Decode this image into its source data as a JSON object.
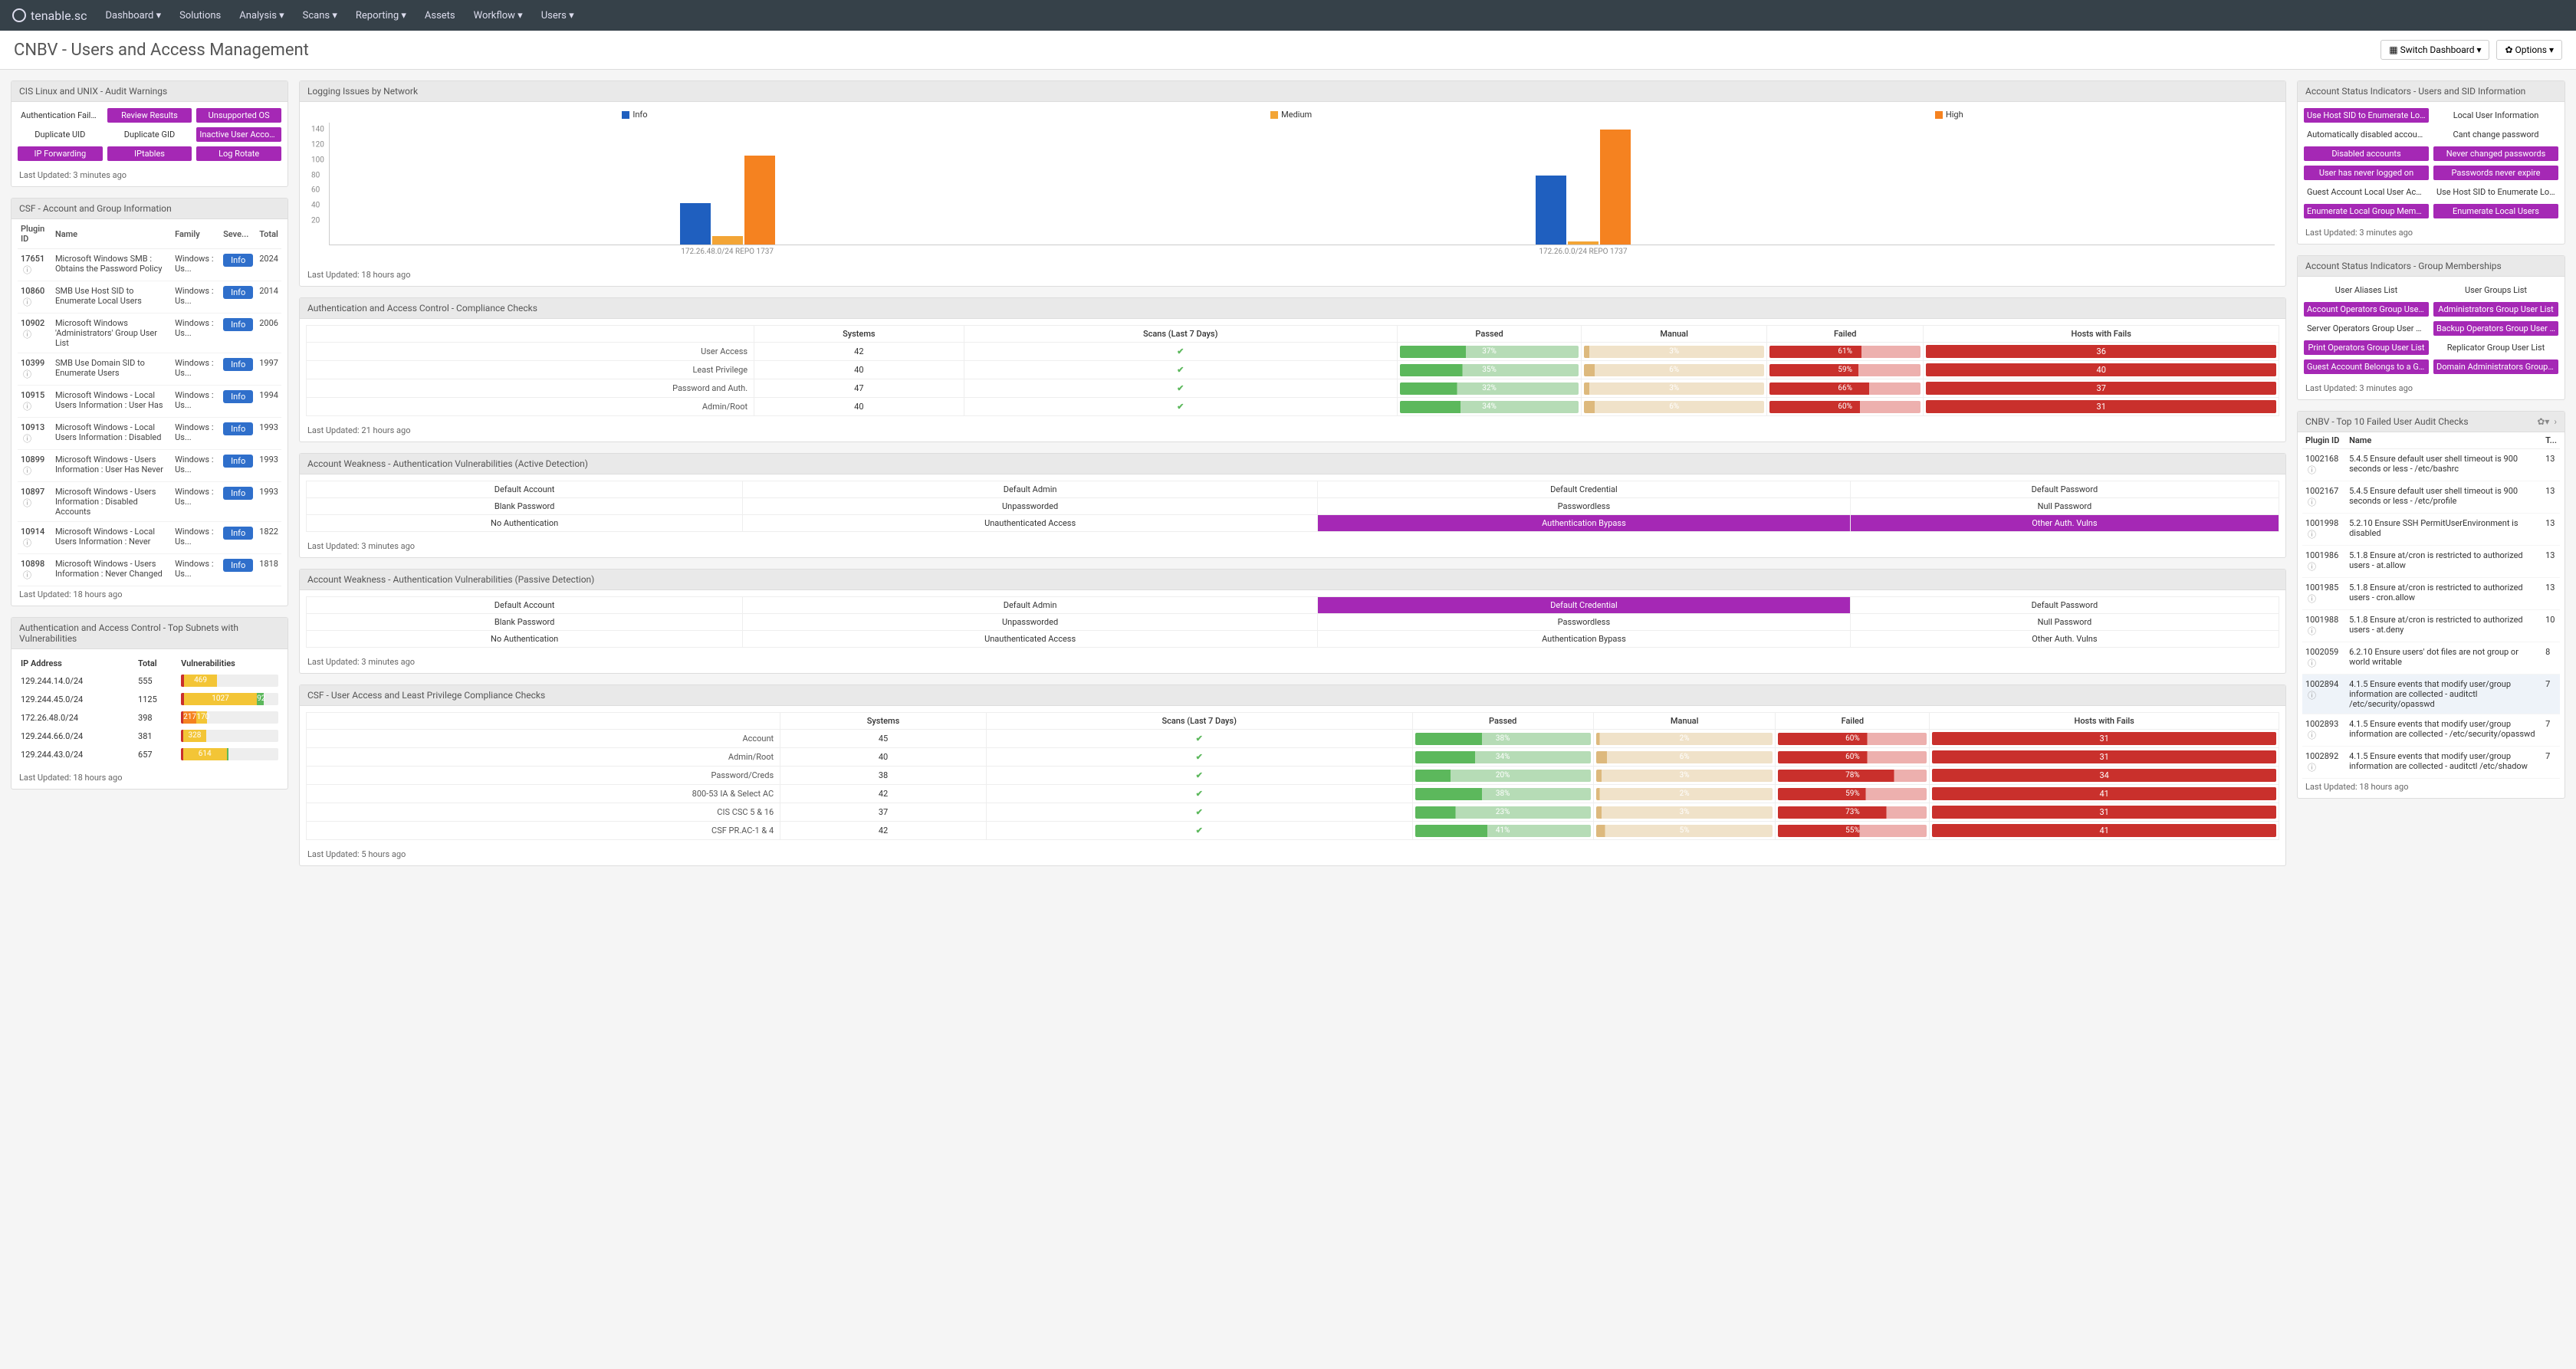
{
  "nav": {
    "brand": "tenable.sc",
    "items": [
      "Dashboard",
      "Solutions",
      "Analysis",
      "Scans",
      "Reporting",
      "Assets",
      "Workflow",
      "Users"
    ],
    "drop": [
      true,
      false,
      true,
      true,
      true,
      false,
      true,
      true
    ]
  },
  "page": {
    "title": "CNBV - Users and Access Management",
    "switch": "Switch Dashboard",
    "options": "Options"
  },
  "cis": {
    "title": "CIS Linux and UNIX - Audit Warnings",
    "foot": "Last Updated: 3 minutes ago",
    "rows": [
      [
        {
          "t": "Authentication Failures",
          "c": "plain"
        },
        {
          "t": "Review Results",
          "c": "purple"
        },
        {
          "t": "Unsupported OS",
          "c": "purple"
        }
      ],
      [
        {
          "t": "Duplicate UID",
          "c": "plain"
        },
        {
          "t": "Duplicate GID",
          "c": "plain"
        },
        {
          "t": "Inactive User Accounts",
          "c": "purple"
        }
      ],
      [
        {
          "t": "IP Forwarding",
          "c": "purple"
        },
        {
          "t": "IPtables",
          "c": "purple"
        },
        {
          "t": "Log Rotate",
          "c": "purple"
        }
      ]
    ]
  },
  "csf": {
    "title": "CSF - Account and Group Information",
    "cols": [
      "Plugin ID",
      "Name",
      "Family",
      "Seve...",
      "Total"
    ],
    "rows": [
      {
        "id": "17651",
        "name": "Microsoft Windows SMB : Obtains the Password Policy",
        "fam": "Windows : Us...",
        "sev": "Info",
        "tot": "2024"
      },
      {
        "id": "10860",
        "name": "SMB Use Host SID to Enumerate Local Users",
        "fam": "Windows : Us...",
        "sev": "Info",
        "tot": "2014"
      },
      {
        "id": "10902",
        "name": "Microsoft Windows 'Administrators' Group User List",
        "fam": "Windows : Us...",
        "sev": "Info",
        "tot": "2006"
      },
      {
        "id": "10399",
        "name": "SMB Use Domain SID to Enumerate Users",
        "fam": "Windows : Us...",
        "sev": "Info",
        "tot": "1997"
      },
      {
        "id": "10915",
        "name": "Microsoft Windows - Local Users Information : User Has",
        "fam": "Windows : Us...",
        "sev": "Info",
        "tot": "1994"
      },
      {
        "id": "10913",
        "name": "Microsoft Windows - Local Users Information : Disabled",
        "fam": "Windows : Us...",
        "sev": "Info",
        "tot": "1993"
      },
      {
        "id": "10899",
        "name": "Microsoft Windows - Users Information : User Has Never",
        "fam": "Windows : Us...",
        "sev": "Info",
        "tot": "1993"
      },
      {
        "id": "10897",
        "name": "Microsoft Windows - Users Information : Disabled Accounts",
        "fam": "Windows : Us...",
        "sev": "Info",
        "tot": "1993"
      },
      {
        "id": "10914",
        "name": "Microsoft Windows - Local Users Information : Never",
        "fam": "Windows : Us...",
        "sev": "Info",
        "tot": "1822"
      },
      {
        "id": "10898",
        "name": "Microsoft Windows - Users Information : Never Changed",
        "fam": "Windows : Us...",
        "sev": "Info",
        "tot": "1818"
      }
    ],
    "foot": "Last Updated: 18 hours ago"
  },
  "subnets": {
    "title": "Authentication and Access Control - Top Subnets with Vulnerabilities",
    "cols": [
      "IP Address",
      "Total",
      "Vulnerabilities"
    ],
    "rows": [
      {
        "ip": "129.244.14.0/24",
        "tot": "555",
        "segs": [
          {
            "c": "red",
            "w": 3
          },
          {
            "c": "yellow",
            "w": 34,
            "t": "469"
          }
        ]
      },
      {
        "ip": "129.244.45.0/24",
        "tot": "1125",
        "segs": [
          {
            "c": "red",
            "w": 3
          },
          {
            "c": "yellow",
            "w": 75,
            "t": "1027"
          },
          {
            "c": "green",
            "w": 7,
            "t": "92"
          }
        ]
      },
      {
        "ip": "172.26.48.0/24",
        "tot": "398",
        "segs": [
          {
            "c": "red",
            "w": 2
          },
          {
            "c": "orange",
            "w": 14,
            "t": "217"
          },
          {
            "c": "yellow",
            "w": 11,
            "t": "170"
          }
        ]
      },
      {
        "ip": "129.244.66.0/24",
        "tot": "381",
        "segs": [
          {
            "c": "red",
            "w": 2
          },
          {
            "c": "yellow",
            "w": 24,
            "t": "328"
          }
        ]
      },
      {
        "ip": "129.244.43.0/24",
        "tot": "657",
        "segs": [
          {
            "c": "red",
            "w": 2
          },
          {
            "c": "yellow",
            "w": 45,
            "t": "614"
          },
          {
            "c": "green",
            "w": 2
          }
        ]
      }
    ],
    "foot": "Last Updated: 18 hours ago"
  },
  "log": {
    "title": "Logging Issues by Network",
    "legend": [
      "Info",
      "Medium",
      "High"
    ],
    "yticks": [
      "140",
      "120",
      "100",
      "80",
      "60",
      "40",
      "20"
    ],
    "clusters": [
      {
        "x": "172.26.48.0/24 REPO 1737",
        "v": [
          54,
          11,
          116
        ]
      },
      {
        "x": "172.26.0.0/24 REPO 1737",
        "v": [
          90,
          4,
          150
        ]
      }
    ],
    "ymax": 160,
    "foot": "Last Updated: 18 hours ago"
  },
  "auth": {
    "title": "Authentication and Access Control - Compliance Checks",
    "cols": [
      "",
      "Systems",
      "Scans (Last 7 Days)",
      "Passed",
      "Manual",
      "Failed",
      "Hosts with Fails"
    ],
    "rows": [
      {
        "l": "User Access",
        "s": "42",
        "p": "37%",
        "m": "3%",
        "f": "61%",
        "h": "36"
      },
      {
        "l": "Least Privilege",
        "s": "40",
        "p": "35%",
        "m": "6%",
        "f": "59%",
        "h": "40"
      },
      {
        "l": "Password and Auth.",
        "s": "47",
        "p": "32%",
        "m": "3%",
        "f": "66%",
        "h": "37"
      },
      {
        "l": "Admin/Root",
        "s": "40",
        "p": "34%",
        "m": "6%",
        "f": "60%",
        "h": "31"
      }
    ],
    "foot": "Last Updated: 21 hours ago"
  },
  "awA": {
    "title": "Account Weakness - Authentication Vulnerabilities (Active Detection)",
    "grid": [
      [
        "Default Account",
        "Default Admin",
        "Default Credential",
        "Default Password"
      ],
      [
        "Blank Password",
        "Unpassworded",
        "Passwordless",
        "Null Password"
      ],
      [
        "No Authentication",
        "Unauthenticated Access",
        "Authentication Bypass",
        "Other Auth. Vulns"
      ]
    ],
    "purple": [
      [
        2,
        2
      ],
      [
        2,
        3
      ]
    ],
    "foot": "Last Updated: 3 minutes ago"
  },
  "awP": {
    "title": "Account Weakness - Authentication Vulnerabilities (Passive Detection)",
    "grid": [
      [
        "Default Account",
        "Default Admin",
        "Default Credential",
        "Default Password"
      ],
      [
        "Blank Password",
        "Unpassworded",
        "Passwordless",
        "Null Password"
      ],
      [
        "No Authentication",
        "Unauthenticated Access",
        "Authentication Bypass",
        "Other Auth. Vulns"
      ]
    ],
    "purple": [
      [
        0,
        2
      ]
    ],
    "foot": "Last Updated: 3 minutes ago"
  },
  "csfU": {
    "title": "CSF - User Access and Least Privilege Compliance Checks",
    "cols": [
      "",
      "Systems",
      "Scans (Last 7 Days)",
      "Passed",
      "Manual",
      "Failed",
      "Hosts with Fails"
    ],
    "rows": [
      {
        "l": "Account",
        "s": "45",
        "p": "38%",
        "m": "2%",
        "f": "60%",
        "h": "31"
      },
      {
        "l": "Admin/Root",
        "s": "40",
        "p": "34%",
        "m": "6%",
        "f": "60%",
        "h": "31"
      },
      {
        "l": "Password/Creds",
        "s": "38",
        "p": "20%",
        "m": "3%",
        "f": "78%",
        "h": "34"
      },
      {
        "l": "800-53 IA & Select AC",
        "s": "42",
        "p": "38%",
        "m": "2%",
        "f": "59%",
        "h": "41"
      },
      {
        "l": "CIS CSC 5 & 16",
        "s": "37",
        "p": "23%",
        "m": "3%",
        "f": "73%",
        "h": "31"
      },
      {
        "l": "CSF PR.AC-1 & 4",
        "s": "42",
        "p": "41%",
        "m": "5%",
        "f": "55%",
        "h": "41"
      }
    ],
    "foot": "Last Updated: 5 hours ago"
  },
  "asi": {
    "title": "Account Status Indicators - Users and SID Information",
    "rows": [
      [
        {
          "t": "Use Host SID to Enumerate Local Users",
          "c": "purple"
        },
        {
          "t": "Local User Information",
          "c": "plain"
        }
      ],
      [
        {
          "t": "Automatically disabled accounts",
          "c": "plain"
        },
        {
          "t": "Cant change password",
          "c": "plain"
        }
      ],
      [
        {
          "t": "Disabled accounts",
          "c": "purple"
        },
        {
          "t": "Never changed passwords",
          "c": "purple"
        }
      ],
      [
        {
          "t": "User has never logged on",
          "c": "purple"
        },
        {
          "t": "Passwords never expire",
          "c": "purple"
        }
      ],
      [
        {
          "t": "Guest Account Local User Access",
          "c": "plain"
        },
        {
          "t": "Use Host SID to Enumerate Local Users Witho",
          "c": "plain"
        }
      ],
      [
        {
          "t": "Enumerate Local Group Memberships",
          "c": "purple"
        },
        {
          "t": "Enumerate Local Users",
          "c": "purple"
        }
      ]
    ],
    "foot": "Last Updated: 3 minutes ago"
  },
  "asg": {
    "title": "Account Status Indicators - Group Memberships",
    "rows": [
      [
        {
          "t": "User Aliases List",
          "c": "plain"
        },
        {
          "t": "User Groups List",
          "c": "plain"
        }
      ],
      [
        {
          "t": "Account Operators Group User List",
          "c": "purple"
        },
        {
          "t": "Administrators Group User List",
          "c": "purple"
        }
      ],
      [
        {
          "t": "Server Operators Group User List",
          "c": "plain"
        },
        {
          "t": "Backup Operators Group User List",
          "c": "purple"
        }
      ],
      [
        {
          "t": "Print Operators Group User List",
          "c": "purple"
        },
        {
          "t": "Replicator Group User List",
          "c": "plain"
        }
      ],
      [
        {
          "t": "Guest Account Belongs to a Group",
          "c": "purple"
        },
        {
          "t": "Domain Administrators Group User List",
          "c": "purple"
        }
      ]
    ],
    "foot": "Last Updated: 3 minutes ago"
  },
  "top10": {
    "title": "CNBV - Top 10 Failed User Audit Checks",
    "cols": [
      "Plugin ID",
      "Name",
      "T..."
    ],
    "rows": [
      {
        "id": "1002168",
        "n": "5.4.5 Ensure default user shell timeout is 900 seconds or less - /etc/bashrc",
        "t": "13"
      },
      {
        "id": "1002167",
        "n": "5.4.5 Ensure default user shell timeout is 900 seconds or less - /etc/profile",
        "t": "13"
      },
      {
        "id": "1001998",
        "n": "5.2.10 Ensure SSH PermitUserEnvironment is disabled",
        "t": "13"
      },
      {
        "id": "1001986",
        "n": "5.1.8 Ensure at/cron is restricted to authorized users - at.allow",
        "t": "13"
      },
      {
        "id": "1001985",
        "n": "5.1.8 Ensure at/cron is restricted to authorized users - cron.allow",
        "t": "13"
      },
      {
        "id": "1001988",
        "n": "5.1.8 Ensure at/cron is restricted to authorized users - at.deny",
        "t": "10"
      },
      {
        "id": "1002059",
        "n": "6.2.10 Ensure users' dot files are not group or world writable",
        "t": "8"
      },
      {
        "id": "1002894",
        "n": "4.1.5 Ensure events that modify user/group information are collected - auditctl /etc/security/opasswd",
        "t": "7",
        "hl": true
      },
      {
        "id": "1002893",
        "n": "4.1.5 Ensure events that modify user/group information are collected - /etc/security/opasswd",
        "t": "7"
      },
      {
        "id": "1002892",
        "n": "4.1.5 Ensure events that modify user/group information are collected - auditctl /etc/shadow",
        "t": "7"
      }
    ],
    "foot": "Last Updated: 18 hours ago"
  },
  "chart_data": {
    "type": "bar",
    "title": "Logging Issues by Network",
    "series": [
      {
        "name": "Info",
        "values": [
          54,
          90
        ]
      },
      {
        "name": "Medium",
        "values": [
          11,
          4
        ]
      },
      {
        "name": "High",
        "values": [
          116,
          150
        ]
      }
    ],
    "categories": [
      "172.26.48.0/24 REPO 1737",
      "172.26.0.0/24 REPO 1737"
    ],
    "ylim": [
      0,
      160
    ],
    "yticks": [
      20,
      40,
      60,
      80,
      100,
      120,
      140
    ]
  }
}
